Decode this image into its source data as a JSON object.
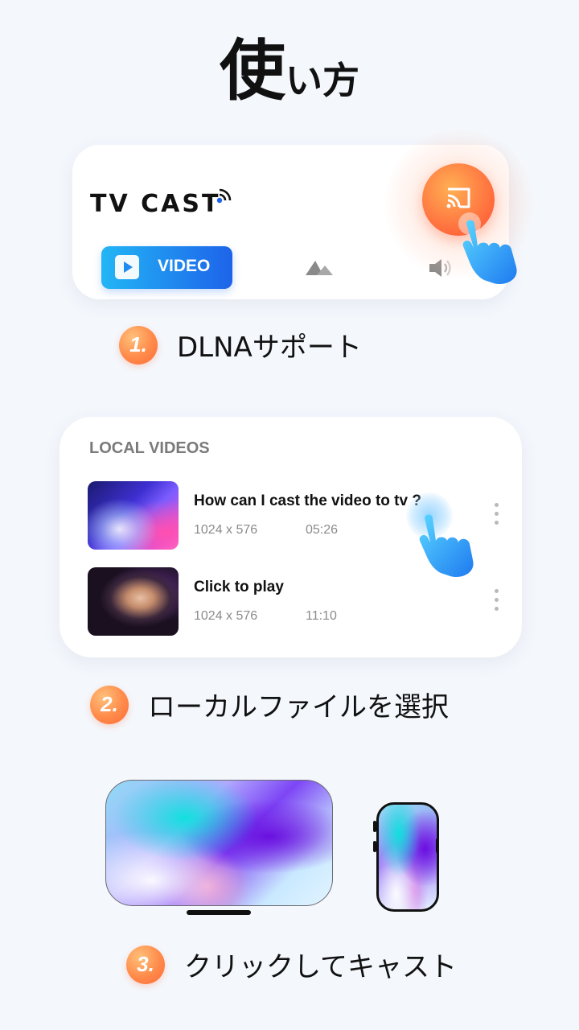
{
  "title": {
    "big": "使",
    "small": "い方"
  },
  "card1": {
    "brand": "TV CAST",
    "video_tab_label": "VIDEO",
    "icons": [
      "cast-icon",
      "play-icon",
      "photo-icon",
      "speaker-icon",
      "hand-pointer-icon",
      "wifi-signal-icon"
    ]
  },
  "steps": [
    {
      "number": "1.",
      "text": "DLNAサポート"
    },
    {
      "number": "2.",
      "text": "ローカルファイルを選択"
    },
    {
      "number": "3.",
      "text": "クリックしてキャスト"
    }
  ],
  "card2": {
    "heading": "LOCAL VIDEOS",
    "items": [
      {
        "name": "How can I cast the video to tv ?",
        "resolution": "1024 x 576",
        "duration": "05:26"
      },
      {
        "name": "Click to play",
        "resolution": "1024 x 576",
        "duration": "11:10"
      }
    ]
  },
  "colors": {
    "background": "#f4f7fc",
    "accent_orange": "#ff6a3c",
    "accent_blue": "#1e63ea"
  }
}
